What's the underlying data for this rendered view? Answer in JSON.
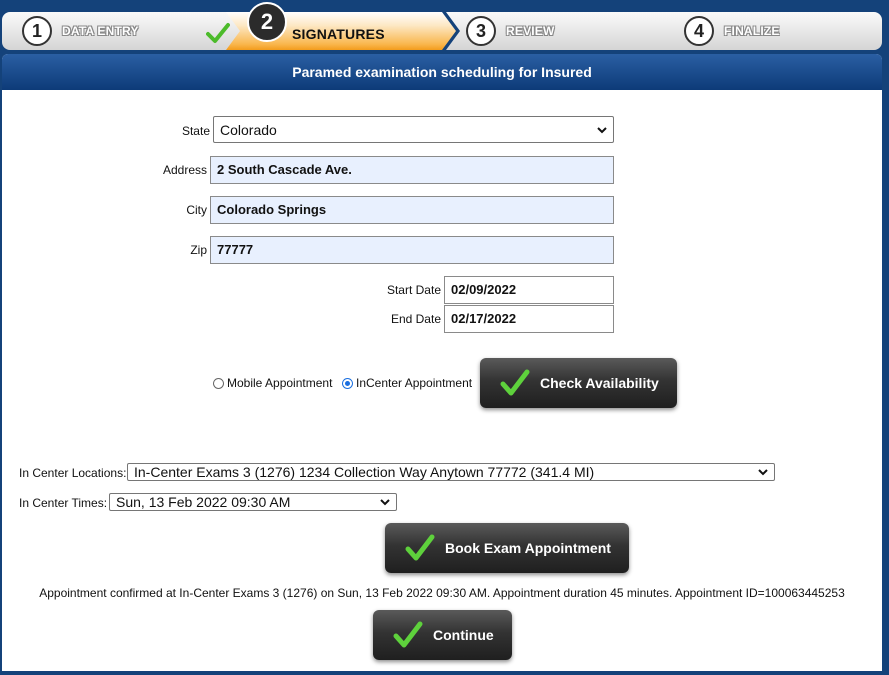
{
  "wizard": {
    "steps": [
      {
        "num": "1",
        "label": "DATA ENTRY"
      },
      {
        "num": "2",
        "label": "SIGNATURES"
      },
      {
        "num": "3",
        "label": "REVIEW"
      },
      {
        "num": "4",
        "label": "FINALIZE"
      }
    ],
    "active_step": 2
  },
  "panel": {
    "title": "Paramed examination scheduling for Insured"
  },
  "form": {
    "state_label": "State",
    "state_value": "Colorado",
    "address_label": "Address",
    "address_value": "2 South Cascade Ave.",
    "city_label": "City",
    "city_value": "Colorado Springs",
    "zip_label": "Zip",
    "zip_value": "77777",
    "start_date_label": "Start Date",
    "start_date_value": "02/09/2022",
    "end_date_label": "End Date",
    "end_date_value": "02/17/2022"
  },
  "appointment_type": {
    "mobile_label": "Mobile Appointment",
    "incenter_label": "InCenter Appointment",
    "selected": "incenter"
  },
  "buttons": {
    "check_availability": "Check Availability",
    "book_exam": "Book Exam Appointment",
    "continue": "Continue"
  },
  "incenter": {
    "locations_label": "In Center Locations:",
    "location_value": "In-Center Exams 3 (1276) 1234 Collection Way Anytown 77772 (341.4 MI)",
    "times_label": "In Center Times:",
    "time_value": "Sun, 13 Feb 2022 09:30 AM"
  },
  "confirmation": "Appointment confirmed at In-Center Exams 3 (1276) on Sun, 13 Feb 2022 09:30 AM. Appointment duration 45 minutes. Appointment ID=100063445253",
  "colors": {
    "header_blue": "#0d3b78",
    "active_step_orange": "#f39c1c",
    "check_green": "#4cbb2b",
    "input_fill": "#e8f0fe"
  }
}
